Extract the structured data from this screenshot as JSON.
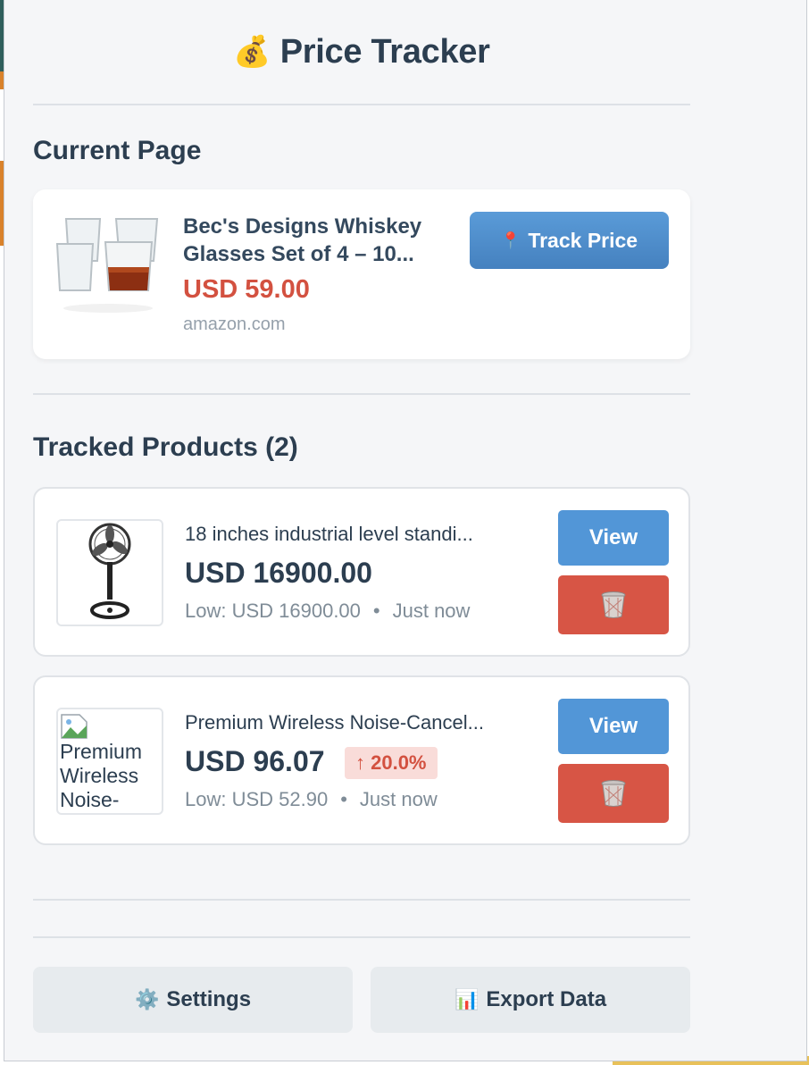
{
  "header": {
    "icon": "money-bag-icon",
    "title": "Price Tracker"
  },
  "current": {
    "section_title": "Current Page",
    "product_name": "Bec's Designs Whiskey Glasses Set of 4 – 10...",
    "price": "USD 59.00",
    "site": "amazon.com",
    "track_button": {
      "icon": "pin-icon",
      "label": "Track Price"
    }
  },
  "tracked": {
    "section_title": "Tracked Products (2)",
    "products": [
      {
        "name": "18 inches industrial level standi...",
        "price": "USD 16900.00",
        "low": "Low: USD 16900.00",
        "updated": "Just now",
        "view_label": "View",
        "delete_icon": "trash-icon"
      },
      {
        "name": "Premium Wireless Noise-Cancel...",
        "image_alt": "Premium Wireless Noise-",
        "price": "USD 96.07",
        "change": "↑ 20.0%",
        "low": "Low: USD 52.90",
        "updated": "Just now",
        "view_label": "View",
        "delete_icon": "trash-icon"
      }
    ]
  },
  "footer": {
    "settings": {
      "icon": "gear-icon",
      "label": "Settings"
    },
    "export": {
      "icon": "bar-chart-icon",
      "label": "Export Data"
    }
  },
  "colors": {
    "accent_blue": "#5296d7",
    "danger_red": "#d75545",
    "price_red": "#d35140",
    "text_dark": "#2c3e50"
  }
}
